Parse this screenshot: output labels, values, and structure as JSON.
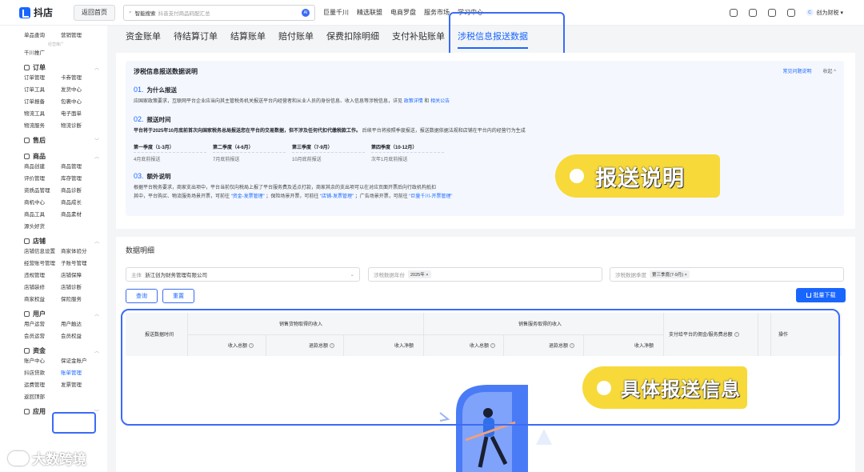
{
  "topbar": {
    "logo": "抖店",
    "back": "返回首页",
    "search_label": "智能搜索",
    "search_placeholder": "抖音支付商品码配汇总",
    "ai": "AI",
    "nav": [
      "巨量千川",
      "精选联盟",
      "电商罗盘",
      "服务市场",
      "学习中心"
    ],
    "account": "创为财税",
    "avatar_letter": "C"
  },
  "sidebar": {
    "top_items": [
      "单品查询",
      "营销管理"
    ],
    "sub_caption": "经营推广",
    "single": "千川推广",
    "groups": [
      {
        "title": "订单",
        "items": [
          "订单管理",
          "卡券管理",
          "订单工具",
          "发货中心",
          "订单报备",
          "包裹中心",
          "物流工具",
          "电子面单",
          "物流服务",
          "物流诊断"
        ]
      },
      {
        "title": "售后",
        "items": []
      },
      {
        "title": "商品",
        "items": [
          "商品创建",
          "商品管理",
          "评价管理",
          "库存管理",
          "资质品管理",
          "商品诊断",
          "商机中心",
          "商品成长",
          "商品工具",
          "商品素材",
          "源头好货"
        ]
      },
      {
        "title": "店铺",
        "items": [
          "店铺信息设置",
          "商家体验分",
          "经营账号管理",
          "子账号管理",
          "违规管理",
          "店铺保障",
          "店铺装修",
          "店铺诊断",
          "商家权益",
          "保险服务"
        ]
      },
      {
        "title": "用户",
        "items": [
          "用户运营",
          "用户触达",
          "会员运营",
          "会员权益"
        ]
      },
      {
        "title": "资金",
        "items": [
          "账户中心",
          "保证金账户",
          "抖店贷款",
          "账单管理",
          "运费管理",
          "发票管理",
          "返回顶部"
        ]
      },
      {
        "title": "应用",
        "items": []
      }
    ],
    "active_item": "账单管理"
  },
  "tabs": [
    "资金账单",
    "待结算订单",
    "结算账单",
    "赔付账单",
    "保费扣除明细",
    "支付补贴账单",
    "涉税信息报送数据"
  ],
  "active_tab": "涉税信息报送数据",
  "info": {
    "title": "涉税信息报送数据说明",
    "faq": "常见问题说明",
    "collapse": "收起 ^",
    "s1_no": "01.",
    "s1_title": "为什么报送",
    "s1_text": "应国家政策要求，互联网平台企业应当向其主管税务机关报送平台内经营者和从业人员的身份信息、收入信息等涉税信息，详见",
    "s1_link1": "政策详情",
    "s1_and": "和",
    "s1_link2": "相关公告",
    "s2_no": "02.",
    "s2_title": "报送时间",
    "s2_text": "平台将于2025年10月底前首次向国家税务总局报送您在平台的交易数据，但不涉及任何代扣代缴税款工作。",
    "s2_text2": "后续平台将按照季度报送，报送数据依据法规和店铺在平台内的经营行为生成",
    "quarters": [
      {
        "name": "第一季度（1-3月）",
        "due": "4月底前报送"
      },
      {
        "name": "第二季度（4-6月）",
        "due": "7月底前报送"
      },
      {
        "name": "第三季度（7-9月）",
        "due": "10月底前报送"
      },
      {
        "name": "第四季度（10-12月）",
        "due": "次年1月底前报送"
      }
    ],
    "s3_no": "03.",
    "s3_title": "额外说明",
    "s3_text1": "根据平台税务要求，商家支出项中，平台当前仅向税局上报了平台服务费及适点打款，商家其余的支出项可以在对应页面开票后向行政机构抵扣",
    "s3_text2a": "其中，平台购买、物流服务场景开票，可前往",
    "s3_link1": "“资金-发票管理”",
    "s3_text2b": "；保险场景开票，可前往",
    "s3_link2": "“店铺-发票管理”",
    "s3_text2c": "；广告场景开票，可前往",
    "s3_link3": "“巨量千川-开票管理”"
  },
  "annotations": {
    "tag1": "报送说明",
    "tag2": "具体报送信息"
  },
  "data": {
    "title": "数据明细",
    "subject_label": "主体",
    "subject_value": "浙江创为财务管理有限公司",
    "year_label": "涉税数据年份",
    "year_value": "2025年",
    "quarter_label": "涉税数据季度",
    "quarter_value": "第三季度(7-9月)",
    "query": "查询",
    "reset": "重置",
    "download": "批量下载",
    "table": {
      "col_time": "报送数据时间",
      "group1": "销售货物取得的收入",
      "group2": "销售服务取得的收入",
      "col_fee": "支付给平台的佣金/服务费总额",
      "col_op": "操作",
      "sub": [
        "收入总额",
        "退款总额",
        "收入净额",
        "收入总额",
        "退款总额",
        "收入净额"
      ]
    }
  },
  "watermark": "大数跨境"
}
